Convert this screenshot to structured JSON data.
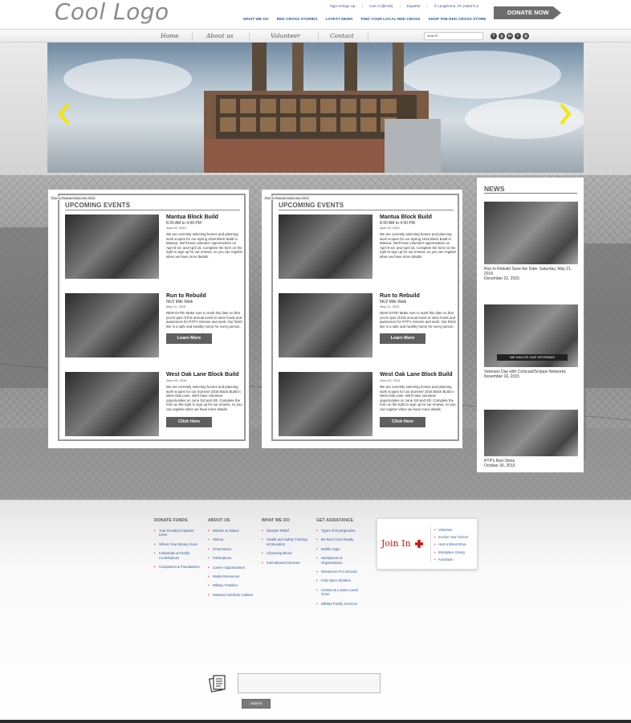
{
  "header": {
    "logo": "Cool Logo",
    "utility": [
      "Sign In/Sign Up",
      "Cart: 0 ($0.00)",
      "Español",
      "Langhorne, PA (19047)"
    ],
    "topnav": [
      "WHAT WE DO",
      "RED CROSS STORIES",
      "LATEST NEWS",
      "FIND YOUR LOCAL RED CROSS",
      "SHOP THE RED CROSS STORE"
    ],
    "donate_label": "DONATE NOW"
  },
  "navbar": {
    "items": [
      "Home",
      "About us",
      "Volunteer",
      "Contact"
    ],
    "search_value": "search",
    "social_icons": [
      "facebook-icon",
      "google-plus-icon",
      "linkedin-icon",
      "twitter-icon",
      "instagram-icon"
    ]
  },
  "hero": {
    "prev_icon": "chevron-left-icon",
    "next_icon": "chevron-right-icon",
    "accent": "#f2e600"
  },
  "cards": [
    {
      "tag": "Run to Rebuild finish line 2015",
      "title": "UPCOMING EVENTS",
      "events": [
        {
          "title": "Mantua Block Build",
          "time": "8:30 AM to 4:00 PM",
          "date": "April 09, 2016",
          "desc": "We are currently selecting homes and planning work scopes for our Spring 2016 Block Build in Mantua. We'll have volunteer opportunities on April 8-10, and April 15. Complete the form on the right to sign up for our emews, so you can register when we have more details."
        },
        {
          "title": "Run to Rebuild",
          "time": "5K/2 Mile Walk",
          "date": "May 21, 2016",
          "desc": "NEW DATE! Make sure to mark this date so that you're part of this annual event to raise funds and awareness for RTP's mission and work. Our finish line is a safe and healthy home for every person.",
          "button": "Learn More"
        },
        {
          "title": "West Oak Lane Block Build",
          "time": "",
          "date": "June 03, 2016",
          "desc": "We are currently selecting homes and planning work scopes for our Summer 2016 Block Build in West Oak Lane. We'll have volunteer opportunities on June 3rd and 4th. Complete the form on the right to sign up for our emews, so you can register when we have more details.",
          "button": "Click Here"
        }
      ]
    },
    {
      "tag": "Run to Rebuild finish line 2015",
      "title": "UPCOMING EVENTS",
      "events": [
        {
          "title": "Mantua Block Build",
          "time": "8:30 AM to 4:00 PM",
          "date": "April 09, 2016",
          "desc": "We are currently selecting homes and planning work scopes for our Spring 2016 Block Build in Mantua. We'll have volunteer opportunities on April 8-10, and April 15. Complete the form on the right to sign up for our emews, so you can register when we have more details."
        },
        {
          "title": "Run to Rebuild",
          "time": "5K/2 Mile Walk",
          "date": "May 21, 2016",
          "desc": "NEW DATE! Make sure to mark this date so that you're part of this annual event to raise funds and awareness for RTP's mission and work. Our finish line is a safe and healthy home for every person.",
          "button": "Learn More"
        },
        {
          "title": "West Oak Lane Block Build",
          "time": "",
          "date": "June 03, 2016",
          "desc": "We are currently selecting homes and planning work scopes for our Summer 2016 Block Build in West Oak Lane. We'll have volunteer opportunities on June 3rd and 4th. Complete the form on the right to sign up for our emews, so you can register when we have more details.",
          "button": "Click Here"
        }
      ]
    }
  ],
  "news": {
    "title": "NEWS",
    "items": [
      {
        "title": "Run to Rebuild Save the Date: Saturday, May 21, 2016",
        "date": "December 22, 2015"
      },
      {
        "title": "Veterans Day with Comcast/Scripps Networks",
        "date": "November 16, 2015",
        "banner": "WE SALUTE OUR VETERANS"
      },
      {
        "title": "RTP's Red Shirts",
        "date": "October 30, 2015"
      }
    ]
  },
  "footer": {
    "columns": [
      {
        "heading": "DONATE FUNDS",
        "links": [
          "Your Donation Impacts Lives",
          "Where Your Money Goes",
          "Individuals & Family Contributions",
          "Companies & Foundations"
        ]
      },
      {
        "heading": "ABOUT US",
        "links": [
          "Mission & Values",
          "History",
          "Governance",
          "Publications",
          "Career Opportunities",
          "Media Resources",
          "Military Families",
          "National Celebrity Cabinet"
        ]
      },
      {
        "heading": "WHAT WE DO",
        "links": [
          "Disaster Relief",
          "Health and Safety Training & Education",
          "Lifesaving Blood",
          "International Services"
        ]
      },
      {
        "heading": "GET ASSISTANCE",
        "links": [
          "Types of Emergencies",
          "Be Red Cross Ready",
          "Mobile Apps",
          "Workplaces & Organizations",
          "Resources For Schools",
          "Find Open Shelters",
          "Contact & Locate Loved Ones",
          "Military Family Services"
        ]
      }
    ],
    "join": {
      "label": "Join In",
      "links": [
        "Volunteer",
        "Involve Your School",
        "Host a Blood Drive",
        "Workplace Giving",
        "Fundraise"
      ],
      "accent": "#cc1111"
    },
    "form": {
      "input_value": "",
      "submit_label": "Submit",
      "icon": "newsletter-icon"
    }
  }
}
